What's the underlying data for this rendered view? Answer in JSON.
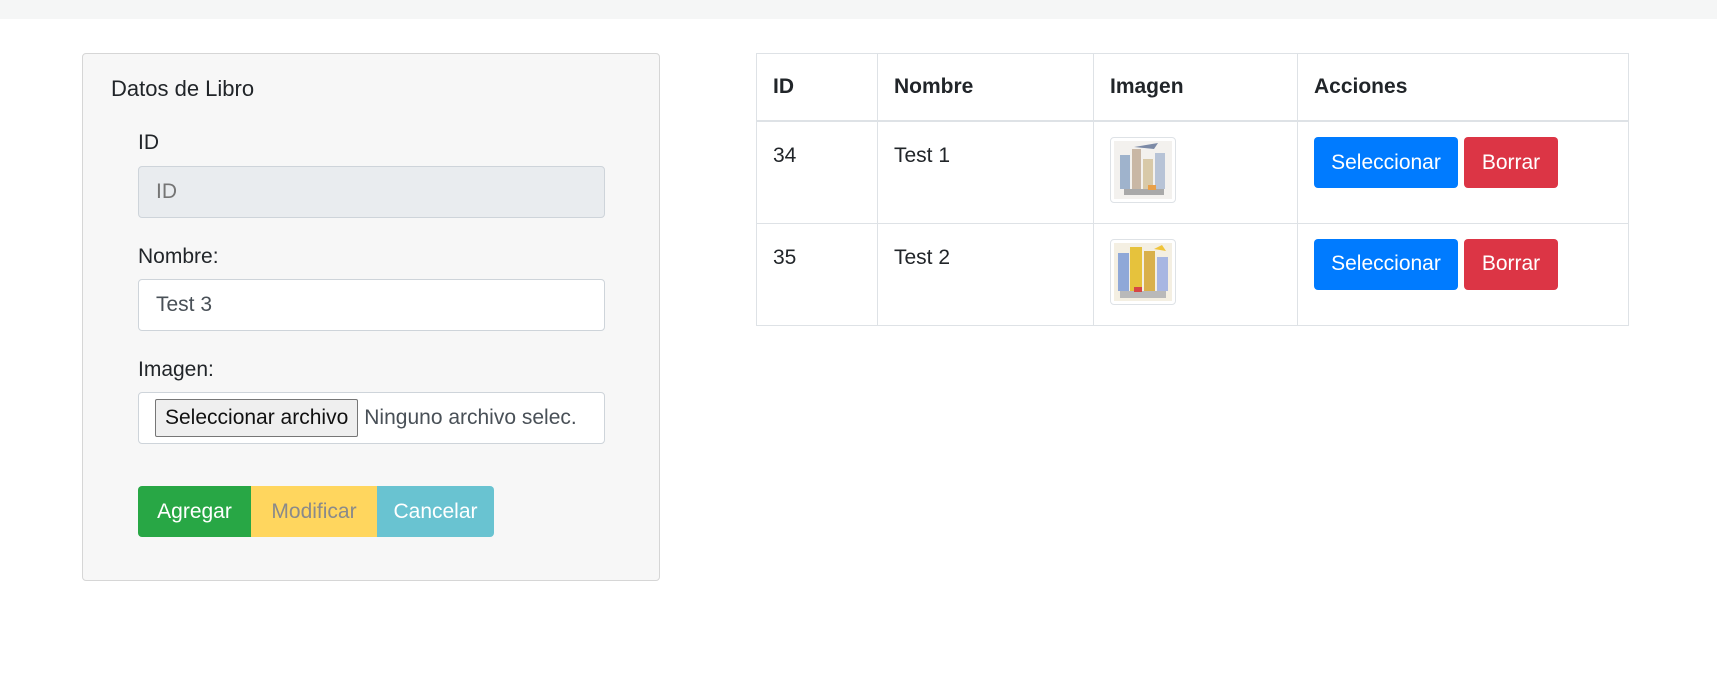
{
  "form": {
    "title": "Datos de Libro",
    "id_label": "ID",
    "id_placeholder": "ID",
    "name_label": "Nombre:",
    "name_value": "Test 3",
    "image_label": "Imagen:",
    "file_button": "Seleccionar archivo",
    "file_status": "Ninguno archivo selec.",
    "buttons": {
      "add": "Agregar",
      "modify": "Modificar",
      "cancel": "Cancelar"
    }
  },
  "table": {
    "headers": [
      "ID",
      "Nombre",
      "Imagen",
      "Acciones"
    ],
    "rows": [
      {
        "id": "34",
        "name": "Test 1",
        "select": "Seleccionar",
        "delete": "Borrar"
      },
      {
        "id": "35",
        "name": "Test 2",
        "select": "Seleccionar",
        "delete": "Borrar"
      }
    ]
  },
  "colors": {
    "primary": "#007bff",
    "danger": "#dc3545",
    "success": "#28a745",
    "warning": "#ffd65e",
    "info": "#69c3d1"
  }
}
